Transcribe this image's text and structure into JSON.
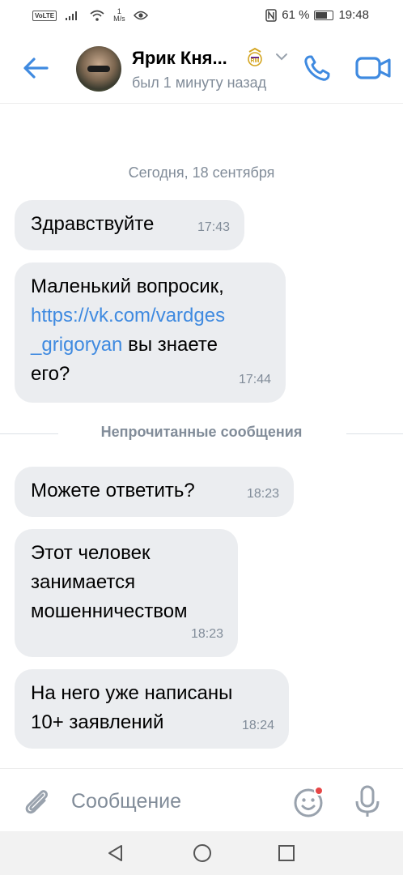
{
  "status_bar": {
    "volte": "VoLTE",
    "net_speed_value": "1",
    "net_speed_unit": "M/s",
    "battery_percent": "61 %",
    "battery_level": 0.61,
    "time": "19:48"
  },
  "header": {
    "contact_name": "Ярик Кня...",
    "status": "был 1 минуту назад",
    "icons": [
      "back-arrow-icon",
      "club-badge-icon",
      "chevron-down-icon",
      "phone-icon",
      "video-camera-icon"
    ]
  },
  "chat": {
    "date_separator": "Сегодня, 18 сентября",
    "unread_separator": "Непрочитанные сообщения",
    "messages": [
      {
        "text": "Здравствуйте",
        "time": "17:43"
      },
      {
        "text_before": "Маленький вопросик,",
        "link_line1": "https://vk.com/vardges",
        "link_line2": "_grigoryan",
        "text_after": " вы знаете",
        "text_end": "его?",
        "time": "17:44"
      },
      {
        "text": "Можете ответить?",
        "time": "18:23"
      },
      {
        "line1": "Этот человек",
        "line2": "занимается",
        "line3": "мошенничеством",
        "time": "18:23"
      },
      {
        "line1": "На него уже написаны",
        "line2": "10+ заявлений",
        "time": "18:24"
      }
    ]
  },
  "composer": {
    "placeholder": "Сообщение",
    "icons": [
      "paperclip-icon",
      "smile-icon",
      "microphone-icon"
    ],
    "accent_color": "#3f8ae0",
    "notification_dot_color": "#e64646"
  },
  "nav_bar": {
    "icons": [
      "nav-back-icon",
      "nav-home-icon",
      "nav-recents-icon"
    ]
  }
}
